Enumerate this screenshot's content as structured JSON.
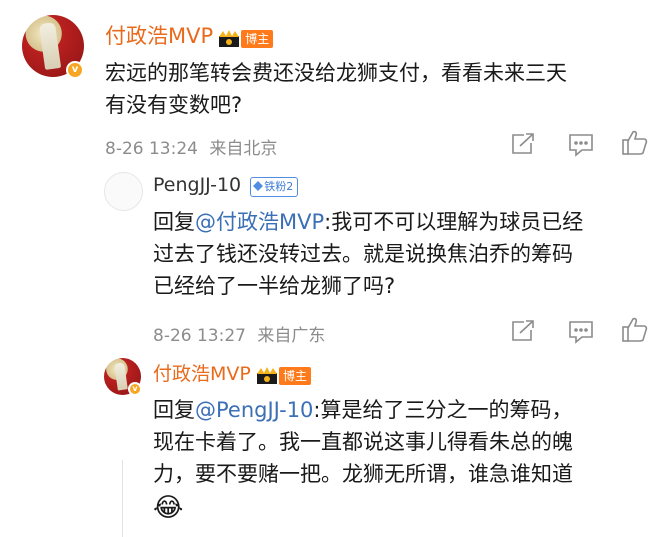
{
  "comment": {
    "username": "付政浩MVP",
    "tag": "博主",
    "text_line1": "宏远的那笔转会费还没给龙狮支付，看看未来三天",
    "text_line2": "有没有变数吧?",
    "date": "8-26 13:24",
    "location": "来自北京"
  },
  "replies": [
    {
      "username": "PengJJ-10",
      "fan_badge": "铁粉2",
      "reply_prefix": "回复",
      "mention": "@付政浩MVP",
      "line1": ":我可不可以理解为球员已经",
      "line2": "过去了钱还没转过去。就是说换焦泊乔的筹码",
      "line3": "已经给了一半给龙狮了吗?",
      "date": "8-26 13:27",
      "location": "来自广东"
    },
    {
      "username": "付政浩MVP",
      "tag": "博主",
      "reply_prefix": "回复",
      "mention": "@PengJJ-10",
      "line1": ":算是给了三分之一的筹码，",
      "line2": "现在卡着了。我一直都说这事儿得看朱总的魄",
      "line3": "力，要不要赌一把。龙狮无所谓，谁急谁知道",
      "emoji": "😂"
    }
  ],
  "icons": {
    "share": "share-icon",
    "comment": "comment-icon",
    "like": "like-icon"
  },
  "colors": {
    "username": "#ea6a1d",
    "mention": "#3b6fb6",
    "meta": "#8c8c8c",
    "tag": "#ff7a1a",
    "fan_badge": "#4f8ee0"
  }
}
